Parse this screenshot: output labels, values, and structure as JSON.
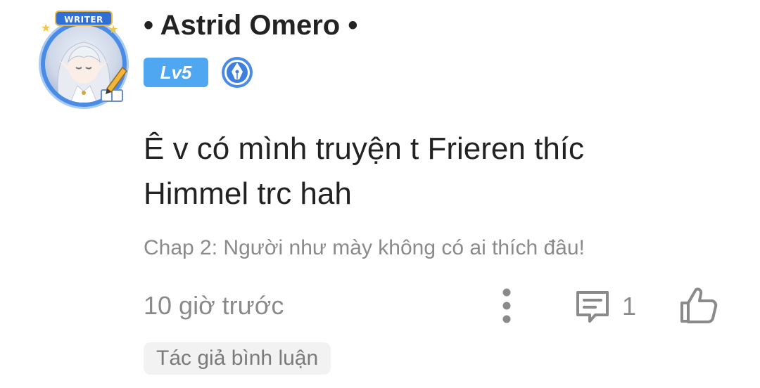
{
  "comment": {
    "avatar": {
      "icon": "avatar-image",
      "frame_label": "WRITER",
      "accent_color": "#4a8be6"
    },
    "username": "• Astrid Omero •",
    "level_badge": "Lv5",
    "level_badge_color": "#4fa7f1",
    "author_badge_icon": "pen-nib-icon",
    "text": "Ê v có mình truyện t Frieren thíc Himmel trc hah",
    "chapter_ref": "Chap 2: Người như mày không có ai thích đâu!",
    "timestamp": "10 giờ trước",
    "actions": {
      "more_icon": "more-vertical-icon",
      "reply_icon": "comment-icon",
      "reply_count": "1",
      "like_icon": "thumbs-up-icon"
    },
    "author_tag": "Tác giả bình luận"
  }
}
